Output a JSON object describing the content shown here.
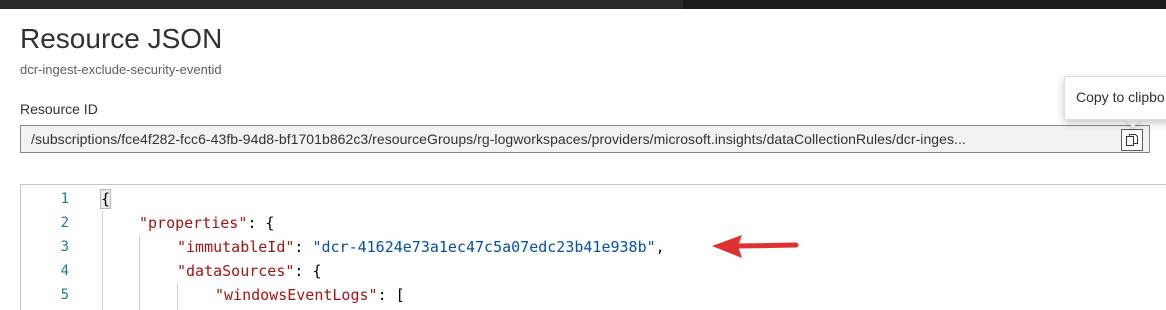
{
  "header": {
    "title": "Resource JSON",
    "subtitle": "dcr-ingest-exclude-security-eventid"
  },
  "resource_id": {
    "label": "Resource ID",
    "value": "/subscriptions/fce4f282-fcc6-43fb-94d8-bf1701b862c3/resourceGroups/rg-logworkspaces/providers/microsoft.insights/dataCollectionRules/dcr-inges...",
    "copy_icon": "copy-icon",
    "tooltip": "Copy to clipbo"
  },
  "editor": {
    "line_numbers": [
      "1",
      "2",
      "3",
      "4",
      "5"
    ],
    "line1": {
      "punct": "{"
    },
    "line2": {
      "key": "\"properties\"",
      "punct": ": {"
    },
    "line3": {
      "key": "\"immutableId\"",
      "sep": ": ",
      "value": "\"dcr-41624e73a1ec47c5a07edc23b41e938b\"",
      "punct": ","
    },
    "line4": {
      "key": "\"dataSources\"",
      "punct": ": {"
    },
    "line5": {
      "key": "\"windowsEventLogs\"",
      "punct": ": ["
    }
  },
  "colors": {
    "json_key": "#a31515",
    "json_string": "#0451a5",
    "line_number": "#237893",
    "annotation_arrow": "#e03131"
  }
}
